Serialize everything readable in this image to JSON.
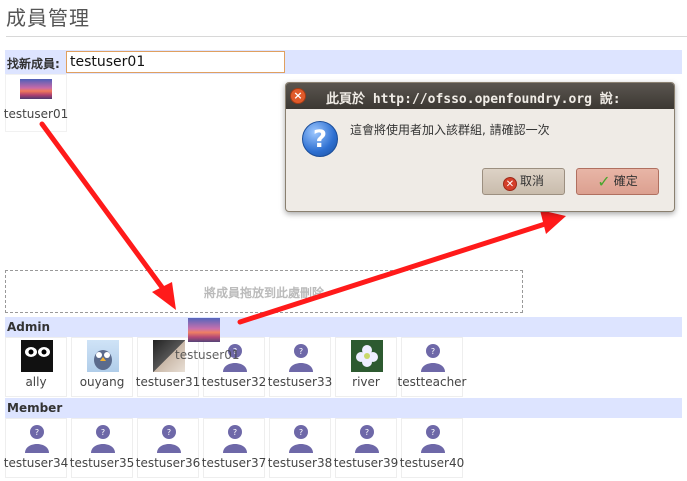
{
  "page": {
    "title": "成員管理"
  },
  "find_member": {
    "label": "找新成員:",
    "input_value": "testuser01",
    "result": {
      "name": "testuser01"
    }
  },
  "drop_zone": {
    "text": "將成員拖放到此處刪除"
  },
  "dragging_item": {
    "name": "testuser01"
  },
  "admin": {
    "label": "Admin",
    "members": [
      {
        "name": "ally",
        "avatar": "ally-avatar"
      },
      {
        "name": "ouyang",
        "avatar": "ouyang-avatar"
      },
      {
        "name": "testuser31",
        "avatar": "photo-avatar"
      },
      {
        "name": "testuser32",
        "avatar": "default-avatar"
      },
      {
        "name": "testuser33",
        "avatar": "default-avatar"
      },
      {
        "name": "river",
        "avatar": "flower-avatar"
      },
      {
        "name": "testteacher",
        "avatar": "default-avatar"
      }
    ]
  },
  "member": {
    "label": "Member",
    "members": [
      {
        "name": "testuser34"
      },
      {
        "name": "testuser35"
      },
      {
        "name": "testuser36"
      },
      {
        "name": "testuser37"
      },
      {
        "name": "testuser38"
      },
      {
        "name": "testuser39"
      },
      {
        "name": "testuser40"
      }
    ]
  },
  "dialog": {
    "title": "此頁於 http://ofsso.openfoundry.org 說:",
    "message": "這會將使用者加入該群組, 請確認一次",
    "cancel_label": "取消",
    "ok_label": "確定"
  },
  "colors": {
    "section_bar": "#dde4ff",
    "arrow": "#ff1a1a",
    "avatar_default": "#6e68a8"
  }
}
